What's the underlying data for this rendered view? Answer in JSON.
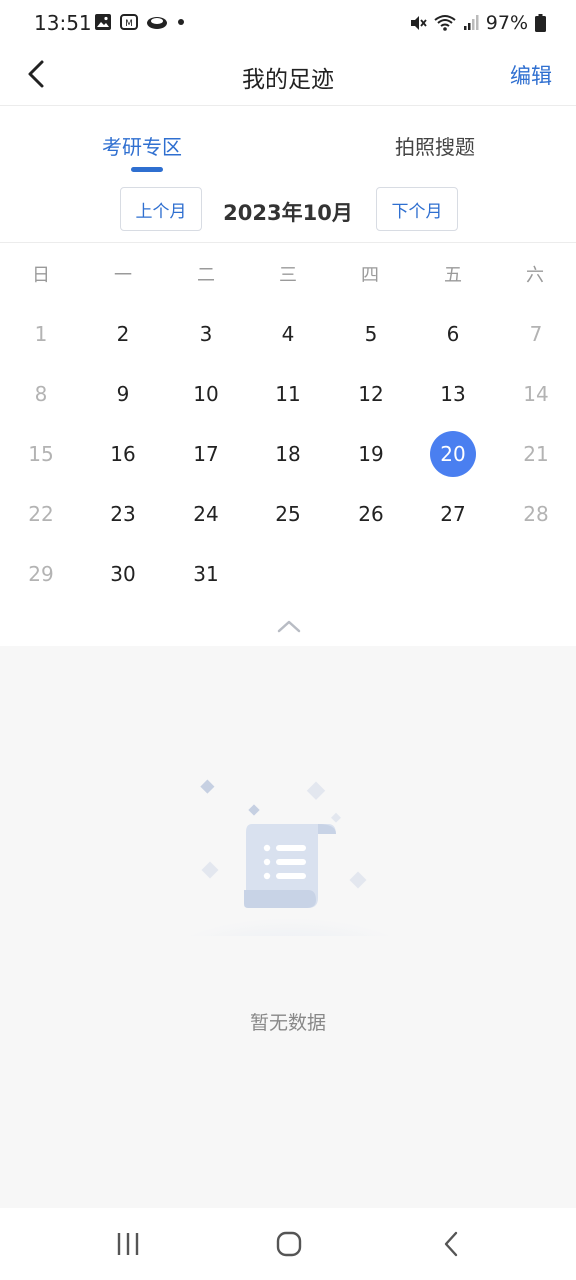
{
  "status_bar": {
    "time": "13:51",
    "battery": "97%",
    "icons_left": [
      "image-icon",
      "app-icon",
      "cloud-icon",
      "dot-icon"
    ],
    "icons_right": [
      "mute-icon",
      "wifi-icon",
      "signal-icon",
      "battery-icon"
    ]
  },
  "header": {
    "title": "我的足迹",
    "edit_label": "编辑"
  },
  "tabs": [
    {
      "label": "考研专区",
      "active": true
    },
    {
      "label": "拍照搜题",
      "active": false
    }
  ],
  "month_nav": {
    "prev_label": "上个月",
    "current": "2023年10月",
    "next_label": "下个月"
  },
  "calendar": {
    "weekdays": [
      "日",
      "一",
      "二",
      "三",
      "四",
      "五",
      "六"
    ],
    "rows": [
      [
        "1",
        "2",
        "3",
        "4",
        "5",
        "6",
        "7"
      ],
      [
        "8",
        "9",
        "10",
        "11",
        "12",
        "13",
        "14"
      ],
      [
        "15",
        "16",
        "17",
        "18",
        "19",
        "20",
        "21"
      ],
      [
        "22",
        "23",
        "24",
        "25",
        "26",
        "27",
        "28"
      ],
      [
        "29",
        "30",
        "31",
        "",
        "",
        "",
        ""
      ]
    ],
    "selected": "20"
  },
  "empty_state": {
    "text": "暂无数据"
  },
  "colors": {
    "accent": "#2f6fd0",
    "selected_day": "#4a7ff0",
    "weekend_text": "#b3b3b3",
    "empty_bg": "#f7f7f7"
  }
}
